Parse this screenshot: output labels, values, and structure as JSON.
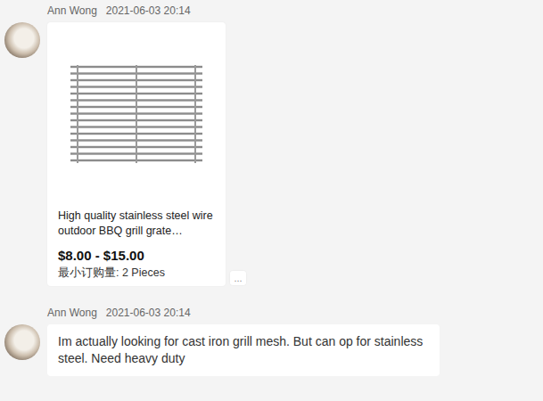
{
  "messages": [
    {
      "kind": "product",
      "sender": "Ann Wong",
      "time": "2021-06-03 20:14",
      "product": {
        "title": "High quality stainless steel wire outdoor BBQ grill grate…",
        "price": "$8.00 - $15.00",
        "moq": "最小订购量: 2 Pieces"
      },
      "more": "..."
    },
    {
      "kind": "text",
      "sender": "Ann Wong",
      "time": "2021-06-03 20:14",
      "text": "Im actually looking for cast iron grill mesh. But can op for stainless steel. Need heavy duty"
    }
  ]
}
